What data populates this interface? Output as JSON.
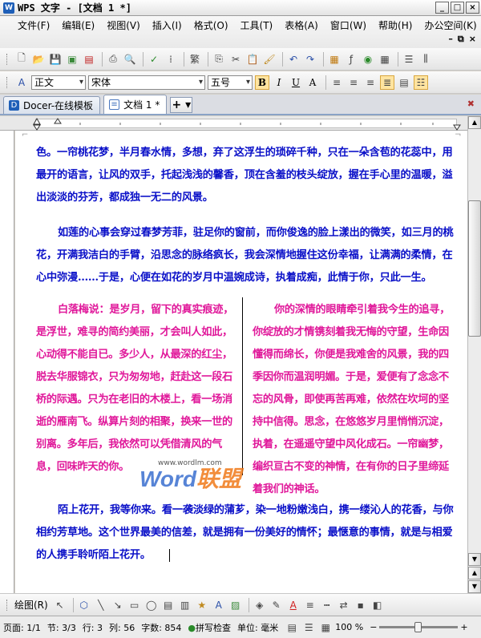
{
  "window": {
    "title": "WPS 文字 - [文档 1 *]"
  },
  "menu": [
    "文件(F)",
    "编辑(E)",
    "视图(V)",
    "插入(I)",
    "格式(O)",
    "工具(T)",
    "表格(A)",
    "窗口(W)",
    "帮助(H)",
    "办公空间(K)"
  ],
  "format": {
    "style": "正文",
    "font": "宋体",
    "size": "五号"
  },
  "tabs": [
    {
      "label": "Docer-在线模板"
    },
    {
      "label": "文档 1 *"
    }
  ],
  "content": {
    "p1": "色。一帘桃花梦，半月春水情，多想，弃了这浮生的琐碎千种，只在一朵含苞的花蕊中，用最开的语言，让风的双手，托起浅浅的馨香，顶在含羞的枝头绽放，握在手心里的温暖，溢出淡淡的芬芳，都成独一无二的风景。",
    "p2": "如莲的心事会穿过春梦芳菲，驻足你的窗前，而你俊逸的脸上漾出的微笑，如三月的桃花，开满我洁白的手臂，沿思念的脉络疯长，我会深情地握住这份幸福，让满满的柔情，在心中弥漫……于是，心便在如花的岁月中温婉成诗，执着成痴，此情于你，只此一生。",
    "col_left": "白落梅说：是岁月，留下的真实痕迹，是浮世，难寻的简约美丽，才会叫人如此，心动得不能自已。多少人，从最深的红尘，脱去华服锦衣，只为匆匆地，赶赴这一段石桥的际遇。只为在老旧的木楼上，看一场消逝的雁南飞。纵算片刻的相聚，换来一世的别离。多年后，我依然可以凭借清风的气息，回味昨天的你。",
    "col_right": "你的深情的眼睛牵引着我今生的追寻，你绽放的才情镌刻着我无悔的守望，生命因懂得而绵长，你便是我难舍的风景，我的四季因你而温润明媚。于是，爱便有了念念不忘的风骨，即使再苦再难，依然在坎坷的坚持中信得。思念，在悠悠岁月里悄悄沉淀，执着，在遥遥守望中风化成石。一帘幽梦，编织亘古不变的神情，在有你的日子里缔延着我们的神话。",
    "p3": "陌上花开，我等你来。看一袭淡绿的蒲芗，染一地粉嫩浅白，携一缕沁人的花香，与你相约芳草地。这个世界最美的信差，就是拥有一份美好的情怀；最惬意的事情，就是与相爱的人携手聆听陌上花开。"
  },
  "watermark": {
    "url": "www.wordlm.com",
    "word": "Word",
    "lianmeng": "联盟"
  },
  "drawbar": {
    "label": "绘图(R)"
  },
  "status": {
    "page": "页面: 1/1",
    "section": "节: 3/3",
    "row": "行: 3",
    "col": "列: 56",
    "chars": "字数: 854",
    "spell": "拼写检查",
    "unit": "单位: 毫米",
    "zoom": "100 %"
  },
  "zoom_percent": 100,
  "accent": "#0a10c8",
  "pink": "#e0189a"
}
